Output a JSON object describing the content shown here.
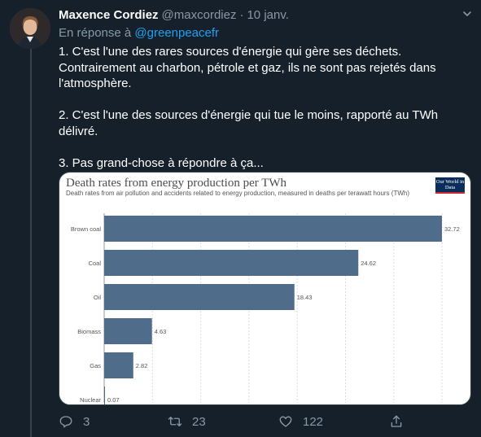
{
  "tweet": {
    "author_name": "Maxence Cordiez",
    "author_handle": "@maxcordiez",
    "separator": "·",
    "timestamp": "10 janv.",
    "reply_prefix": "En réponse à",
    "reply_to": "@greenpeacefr",
    "text": {
      "line1": "1. C'est l'une des rares sources d'énergie qui gère ses déchets.",
      "line2": "Contrairement au charbon, pétrole et gaz, ils ne sont pas rejetés dans",
      "line3": "l'atmosphère.",
      "line4": "2. C'est l'une des sources d'énergie qui tue le moins, rapporté au TWh",
      "line5": "délivré.",
      "line6": "3. Pas grand-chose à répondre à ça..."
    },
    "actions": {
      "reply_count": "3",
      "retweet_count": "23",
      "like_count": "122"
    }
  },
  "icons": {
    "avatar": "profile-photo",
    "caret": "chevron-down-icon",
    "reply": "reply-icon",
    "retweet": "retweet-icon",
    "like": "heart-icon",
    "share": "share-icon"
  },
  "colors": {
    "background": "#15202b",
    "text_primary": "#ffffff",
    "text_secondary": "#8899a6",
    "link": "#1da1f2",
    "bar": "#4f6c8a",
    "owid_box": "#0b2d5c",
    "owid_stripe": "#c42e2e"
  },
  "chart_data": {
    "type": "bar",
    "orientation": "horizontal",
    "title": "Death rates from energy production per TWh",
    "subtitle": "Death rates from air pollution and accidents related to energy production, measured in deaths per terawatt hours (TWh)",
    "logo_text": "Our World in Data",
    "categories": [
      "Brown coal",
      "Coal",
      "Oil",
      "Biomass",
      "Gas",
      "Nuclear"
    ],
    "values": [
      32.72,
      24.62,
      18.43,
      4.63,
      2.82,
      0.07
    ],
    "value_labels": [
      "32.72",
      "24.62",
      "18.43",
      "4.63",
      "2.82",
      "0.07"
    ],
    "xlim": [
      0,
      32.72
    ],
    "grid": true,
    "legend": "none"
  }
}
